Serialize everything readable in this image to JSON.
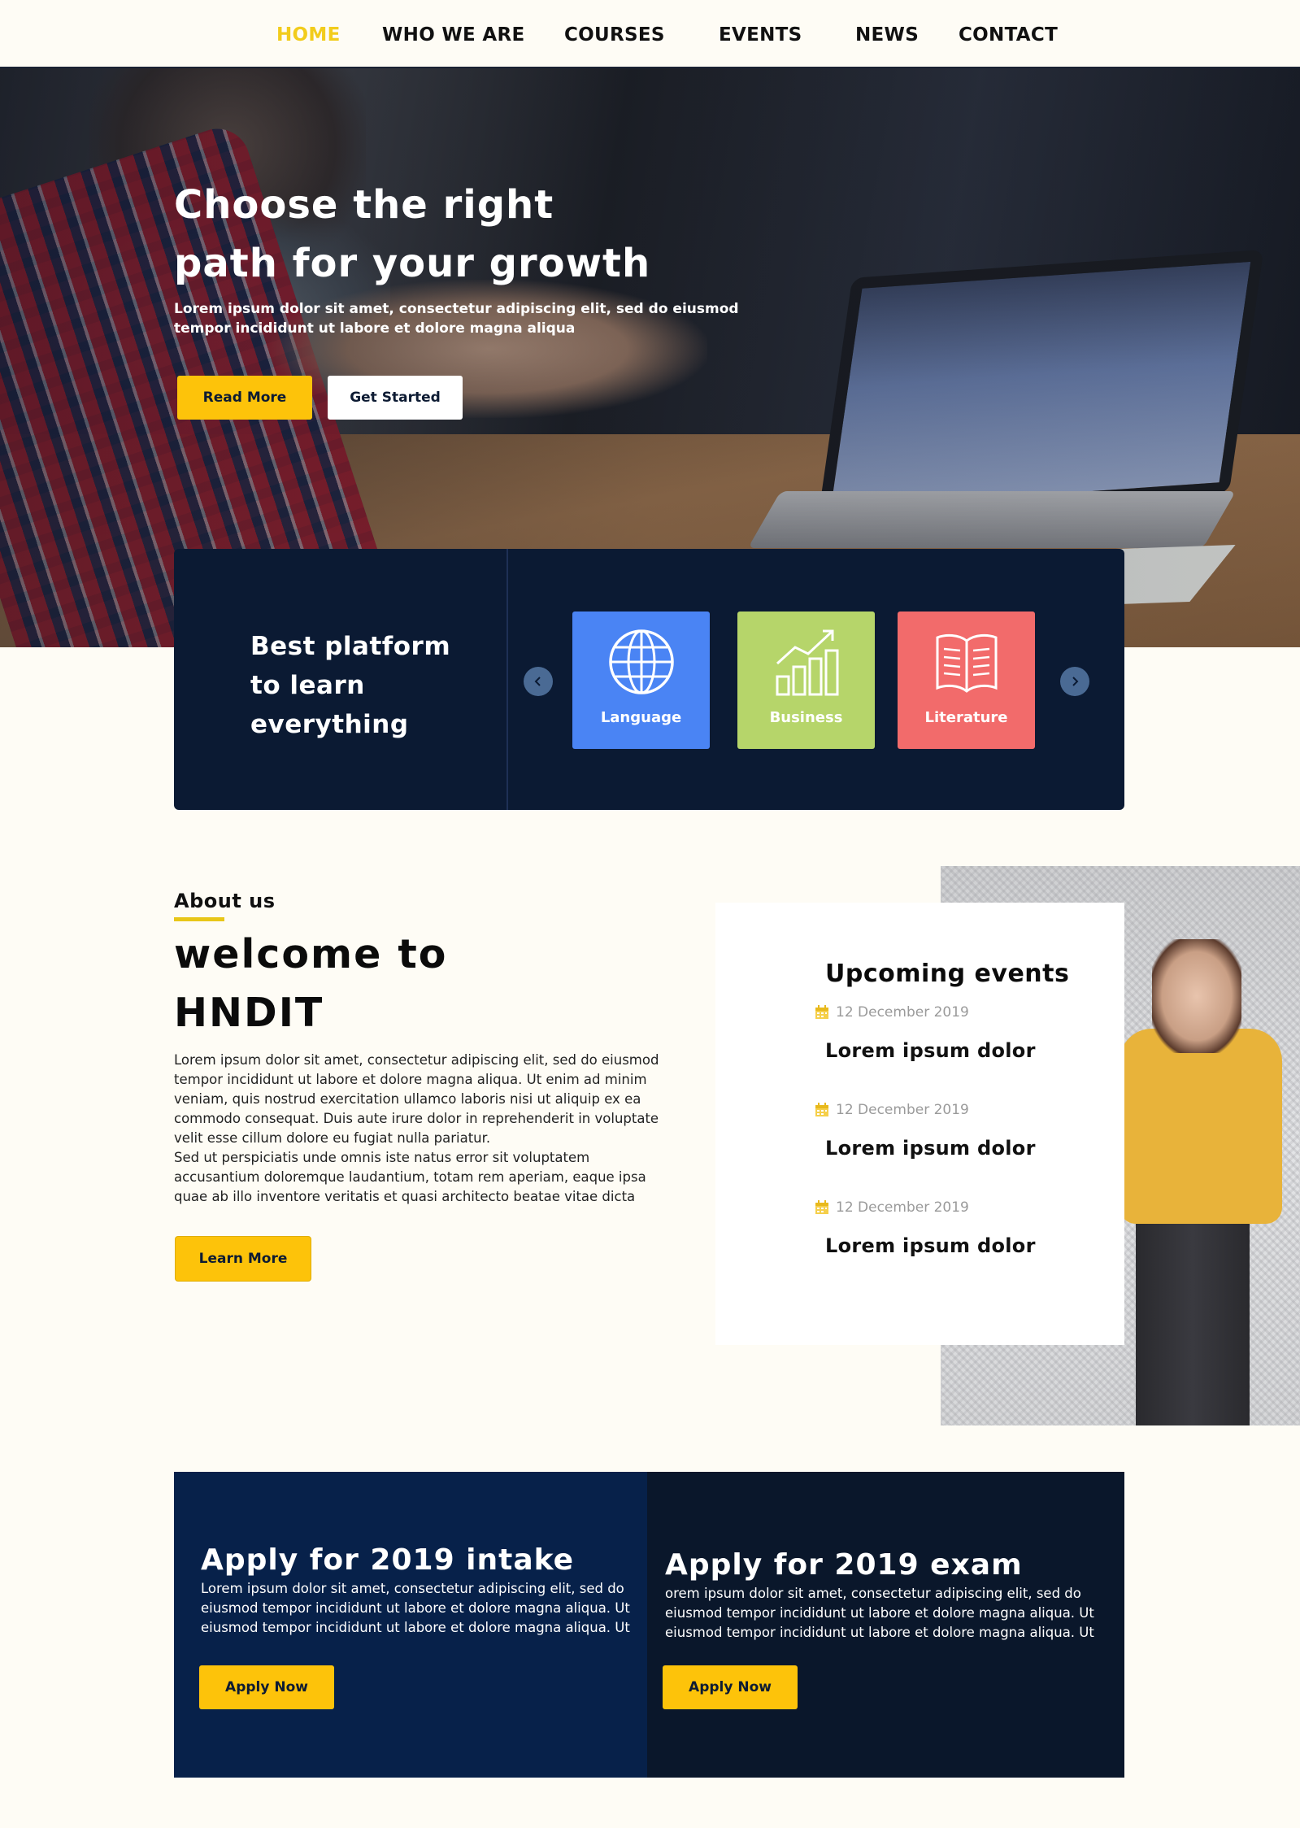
{
  "nav": {
    "items": [
      "HOME",
      "WHO WE ARE",
      "COURSES",
      "EVENTS",
      "NEWS",
      "CONTACT"
    ],
    "active": "HOME",
    "active_color": "#f2cc1c"
  },
  "hero": {
    "title_line1": "Choose the right",
    "title_line2": "path for your growth",
    "subtitle_line1": "Lorem ipsum dolor sit amet, consectetur adipiscing elit, sed do eiusmod",
    "subtitle_line2": "tempor incididunt ut labore et dolore magna aliqua",
    "read_more": "Read More",
    "get_started": "Get Started"
  },
  "categories": {
    "title_line1": "Best platform",
    "title_line2": "to learn",
    "title_line3": "everything",
    "prev_icon": "chevron-left-icon",
    "next_icon": "chevron-right-icon",
    "tiles": [
      {
        "label": "Language",
        "icon": "globe-icon",
        "color": "#4a84f4"
      },
      {
        "label": "Business",
        "icon": "bar-chart-icon",
        "color": "#b6d56a"
      },
      {
        "label": "Literature",
        "icon": "book-icon",
        "color": "#f26b6b"
      }
    ]
  },
  "about": {
    "label": "About us",
    "title_line1": "welcome to",
    "title_line2": "HNDIT",
    "paragraph1": "Lorem ipsum dolor sit amet, consectetur adipiscing elit, sed do eiusmod tempor incididunt ut labore et dolore magna aliqua. Ut enim ad minim veniam, quis nostrud exercitation ullamco laboris nisi ut aliquip ex ea commodo consequat. Duis aute irure dolor in reprehenderit in voluptate velit esse cillum dolore eu fugiat nulla pariatur.",
    "paragraph2": "Sed ut perspiciatis unde omnis iste natus error sit voluptatem accusantium doloremque laudantium, totam rem aperiam, eaque ipsa quae ab illo inventore veritatis et quasi architecto beatae vitae dicta",
    "learn_more": "Learn More"
  },
  "events": {
    "title": "Upcoming events",
    "items": [
      {
        "date": "12 December 2019",
        "name": "Lorem ipsum dolor"
      },
      {
        "date": "12 December 2019",
        "name": "Lorem ipsum dolor"
      },
      {
        "date": "12 December 2019",
        "name": "Lorem ipsum dolor"
      }
    ]
  },
  "apply": {
    "intake": {
      "title": "Apply for 2019 intake",
      "text": "Lorem ipsum dolor sit amet, consectetur adipiscing elit, sed do eiusmod tempor incididunt ut labore et dolore magna aliqua. Ut eiusmod tempor incididunt ut labore et dolore magna aliqua. Ut",
      "button": "Apply Now"
    },
    "exam": {
      "title": "Apply for 2019 exam",
      "text": "orem ipsum dolor sit amet, consectetur adipiscing elit, sed do eiusmod tempor incididunt ut labore et dolore magna aliqua. Ut eiusmod tempor incididunt ut labore et dolore magna aliqua. Ut",
      "button": "Apply Now"
    }
  },
  "colors": {
    "accent_yellow": "#fdc30a",
    "navy": "#0b1a33",
    "page_bg": "#fefcf5"
  }
}
